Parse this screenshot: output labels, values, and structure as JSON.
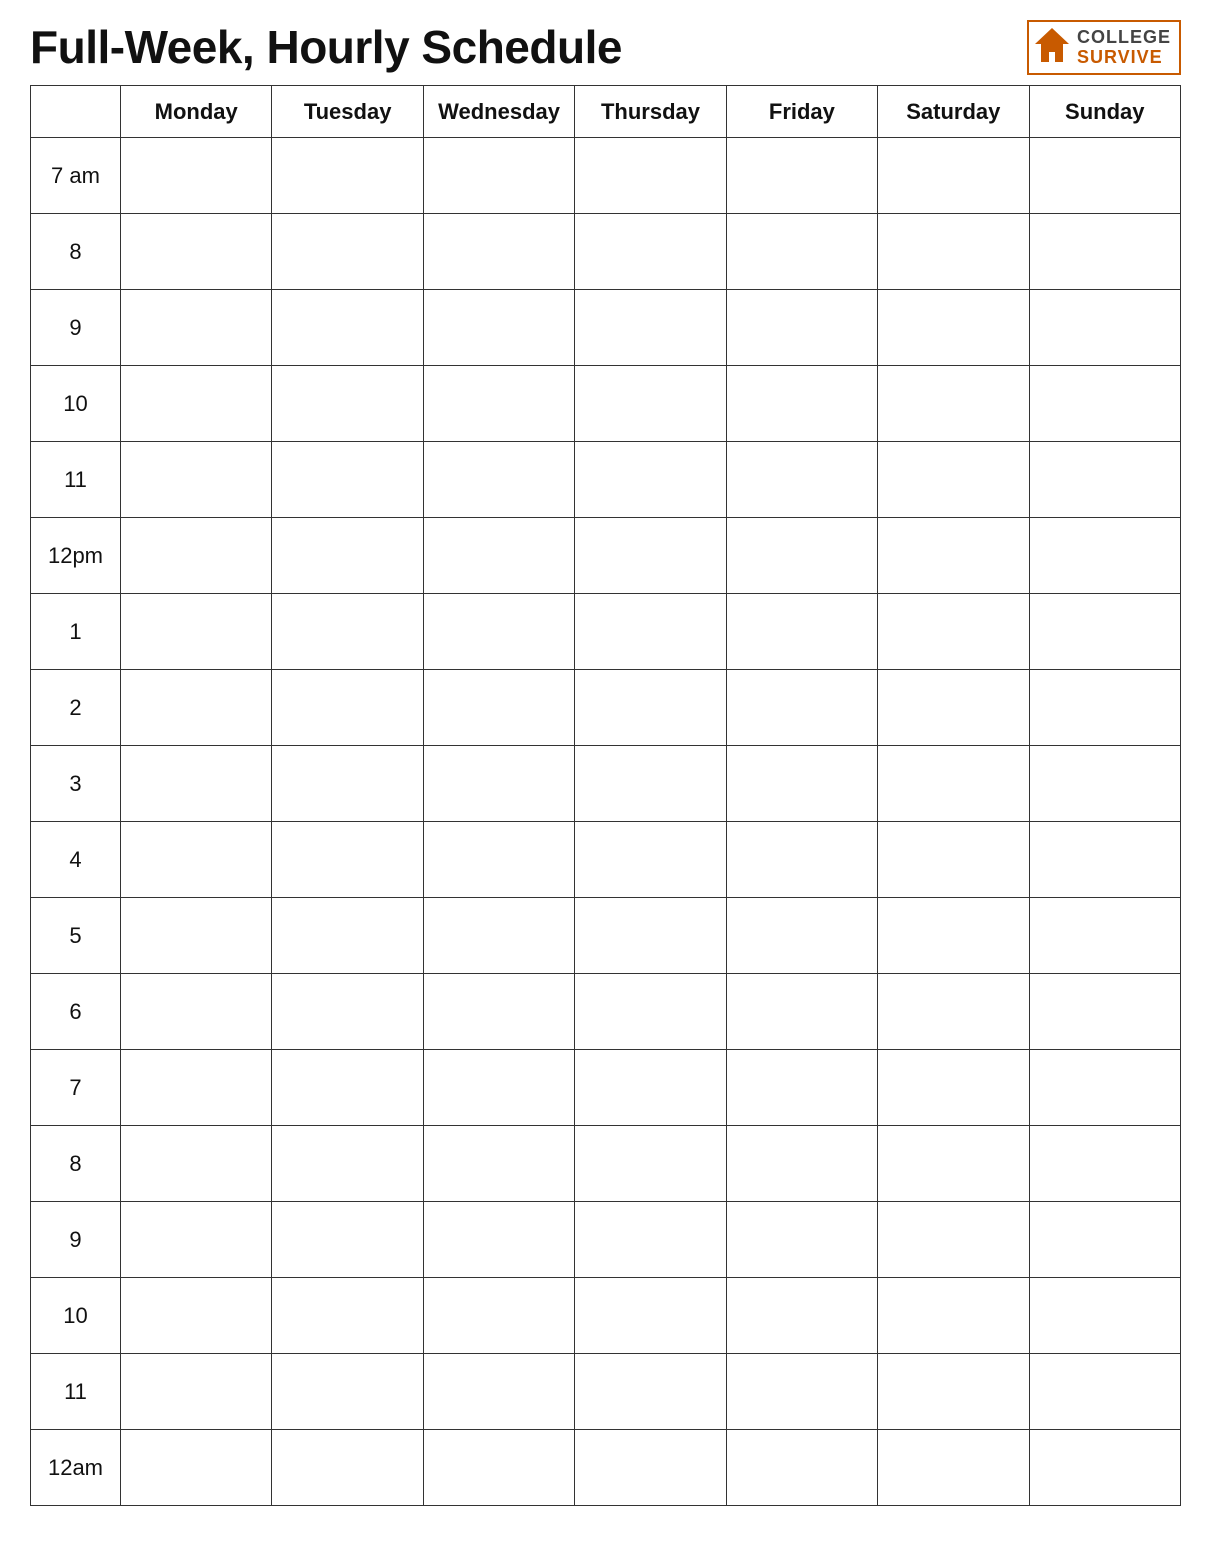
{
  "header": {
    "title": "Full-Week, Hourly Schedule",
    "brand": {
      "college": "COLLEGE",
      "survive": "SURVIVE"
    }
  },
  "table": {
    "days": [
      "Monday",
      "Tuesday",
      "Wednesday",
      "Thursday",
      "Friday",
      "Saturday",
      "Sunday"
    ],
    "times": [
      "7 am",
      "8",
      "9",
      "10",
      "11",
      "12pm",
      "1",
      "2",
      "3",
      "4",
      "5",
      "6",
      "7",
      "8",
      "9",
      "10",
      "11",
      "12am"
    ]
  }
}
